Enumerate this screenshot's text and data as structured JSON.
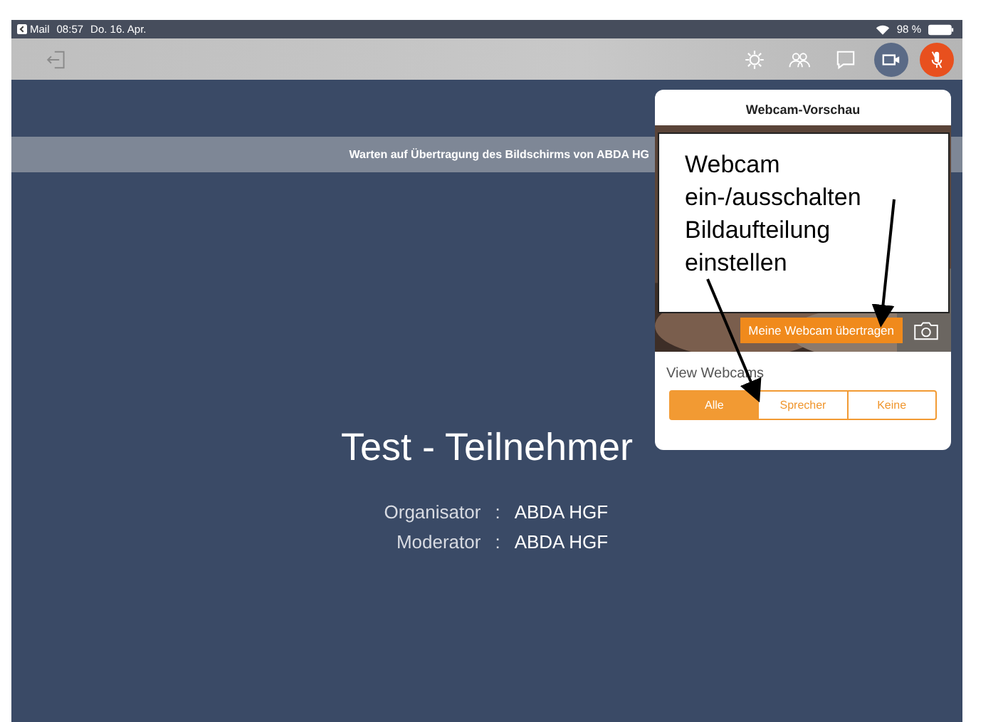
{
  "status_bar": {
    "back_app": "Mail",
    "time": "08:57",
    "date": "Do. 16. Apr.",
    "battery": "98 %"
  },
  "toolbar": {
    "buttons": [
      {
        "kind": "gear",
        "selected": false
      },
      {
        "kind": "people",
        "selected": false
      },
      {
        "kind": "chat",
        "selected": false
      },
      {
        "kind": "camera",
        "selected": true
      },
      {
        "kind": "mic",
        "selected": false
      }
    ]
  },
  "banner": "Warten auf Übertragung des Bildschirms von ABDA HG",
  "meeting": {
    "title": "Test - Teilnehmer",
    "roles": [
      {
        "label": "Organisator",
        "separator": ":",
        "value": "ABDA HGF"
      },
      {
        "label": "Moderator",
        "separator": ":",
        "value": "ABDA HGF"
      }
    ]
  },
  "popover": {
    "title": "Webcam-Vorschau",
    "share_button": "Meine Webcam übertragen",
    "view_label": "View Webcams",
    "segments": [
      {
        "label": "Alle",
        "selected": true
      },
      {
        "label": "Sprecher",
        "selected": false
      },
      {
        "label": "Keine",
        "selected": false
      }
    ]
  },
  "callout": {
    "lines": [
      "Webcam",
      "ein-/ausschalten",
      "Bildaufteilung",
      "einstellen"
    ]
  }
}
